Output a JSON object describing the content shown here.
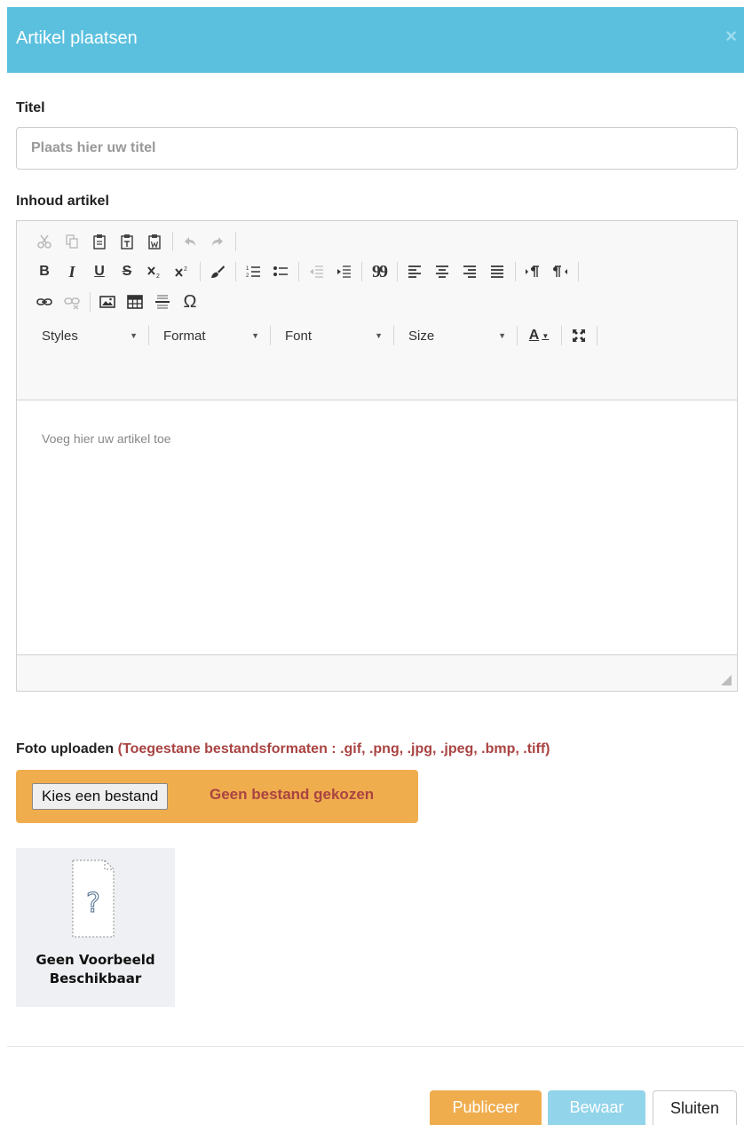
{
  "dialog": {
    "title": "Artikel plaatsen",
    "close_symbol": "×"
  },
  "title_field": {
    "label": "Titel",
    "placeholder": "Plaats hier uw titel",
    "value": ""
  },
  "content_field": {
    "label": "Inhoud artikel",
    "placeholder": "Voeg hier uw artikel toe",
    "combos": {
      "styles": "Styles",
      "format": "Format",
      "font": "Font",
      "size": "Size"
    },
    "glyphs": {
      "bold": "B",
      "italic": "I",
      "underline": "U",
      "strike": "S",
      "blockquote": "99",
      "special_char": "Ω"
    }
  },
  "upload": {
    "label": "Foto uploaden",
    "hint": "(Toegestane bestandsformaten : .gif, .png, .jpg, .jpeg, .bmp, .tiff)",
    "choose_button": "Kies een bestand",
    "status": "Geen bestand gekozen"
  },
  "preview": {
    "line1": "Geen Voorbeeld",
    "line2": "Beschikbaar"
  },
  "footer": {
    "publish": "Publiceer",
    "save": "Bewaar",
    "close": "Sluiten"
  },
  "colors": {
    "header": "#5bc0de",
    "warning": "#f0ad4e",
    "danger_text": "#a94442"
  }
}
